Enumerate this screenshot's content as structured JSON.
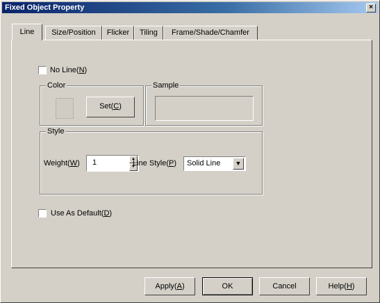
{
  "window": {
    "title": "Fixed Object Property",
    "close_glyph": "×"
  },
  "tabs": [
    {
      "label": "Line"
    },
    {
      "label": "Size/Position"
    },
    {
      "label": "Flicker"
    },
    {
      "label": "Tiling"
    },
    {
      "label": "Frame/Shade/Chamfer"
    }
  ],
  "line_tab": {
    "no_line": {
      "label": "No Line",
      "mnemonic": "N",
      "checked": false
    },
    "color": {
      "group_label": "Color",
      "set_label": "Set",
      "set_mnemonic": "C"
    },
    "sample": {
      "group_label": "Sample"
    },
    "style": {
      "group_label": "Style",
      "weight_label": "Weight",
      "weight_mnemonic": "W",
      "weight_value": "1",
      "line_style_label": "Line Style",
      "line_style_mnemonic": "P",
      "line_style_value": "Solid Line"
    },
    "use_default": {
      "label": "Use As Default",
      "mnemonic": "D",
      "checked": false
    }
  },
  "buttons": {
    "apply": {
      "label": "Apply",
      "mnemonic": "A"
    },
    "ok": {
      "label": "OK"
    },
    "cancel": {
      "label": "Cancel"
    },
    "help": {
      "label": "Help",
      "mnemonic": "H"
    }
  },
  "icons": {
    "spin_up": "▲",
    "spin_down": "▼",
    "dropdown": "▼"
  }
}
